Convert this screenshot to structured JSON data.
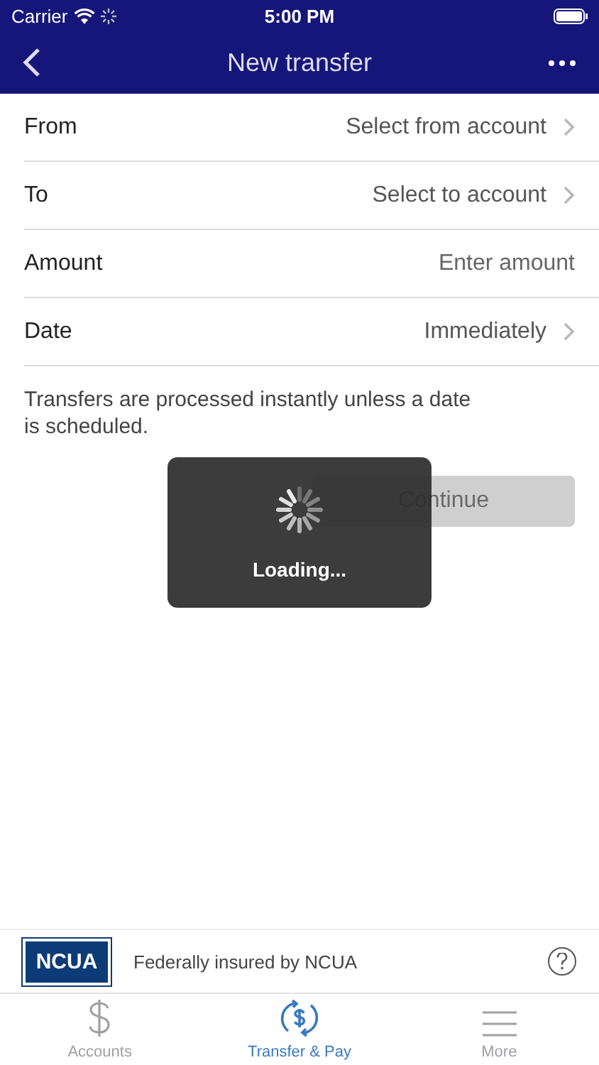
{
  "status_bar": {
    "carrier": "Carrier",
    "time": "5:00 PM"
  },
  "nav": {
    "title": "New transfer"
  },
  "rows": [
    {
      "label": "From",
      "kind": "select",
      "value": "Select from account"
    },
    {
      "label": "To",
      "kind": "select",
      "value": "Select to account"
    },
    {
      "label": "Amount",
      "kind": "input",
      "placeholder": "Enter amount"
    },
    {
      "label": "Date",
      "kind": "select",
      "value": "Immediately"
    }
  ],
  "note": "Transfers are processed instantly unless a date is scheduled.",
  "continue_button": {
    "label": "Continue",
    "disabled": true
  },
  "loading": {
    "text": "Loading..."
  },
  "footer": {
    "logo": "NCUA",
    "text": "Federally insured by NCUA"
  },
  "tabs": [
    {
      "label": "Accounts",
      "kind": "dollar",
      "selected": false
    },
    {
      "label": "Transfer & Pay",
      "kind": "transfer",
      "selected": true
    },
    {
      "label": "More",
      "kind": "menu",
      "selected": false
    }
  ]
}
